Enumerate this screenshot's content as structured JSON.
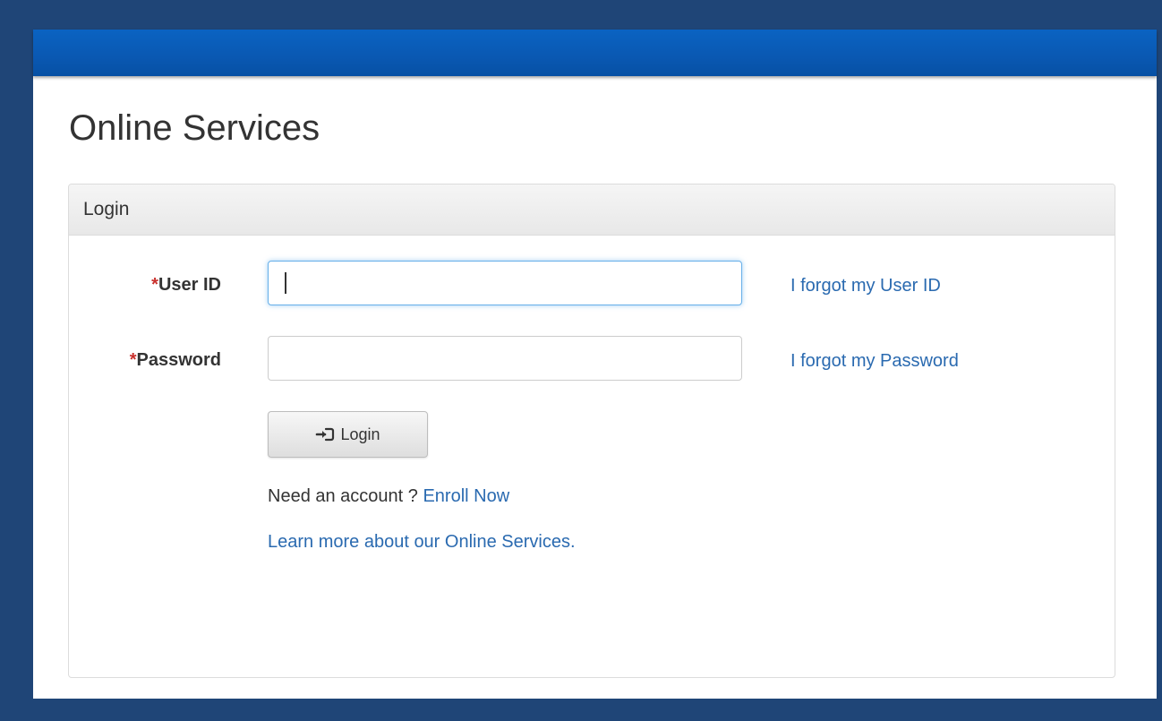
{
  "page": {
    "title": "Online Services"
  },
  "panel": {
    "heading": "Login"
  },
  "form": {
    "user_id": {
      "required_mark": "*",
      "label": "User ID",
      "value": "",
      "placeholder": "",
      "forgot_link": "I forgot my User ID"
    },
    "password": {
      "required_mark": "*",
      "label": "Password",
      "value": "",
      "placeholder": "",
      "forgot_link": "I forgot my Password"
    },
    "login_button": {
      "label": "Login",
      "icon": "login-icon"
    },
    "enroll": {
      "prompt": "Need an account ? ",
      "link": "Enroll Now"
    },
    "learn_more": "Learn more about our Online Services."
  },
  "colors": {
    "background": "#1f4577",
    "top_bar": "#0a58b2",
    "link": "#2a6ab0",
    "required": "#c9302c",
    "focus_border": "#66afe9"
  }
}
